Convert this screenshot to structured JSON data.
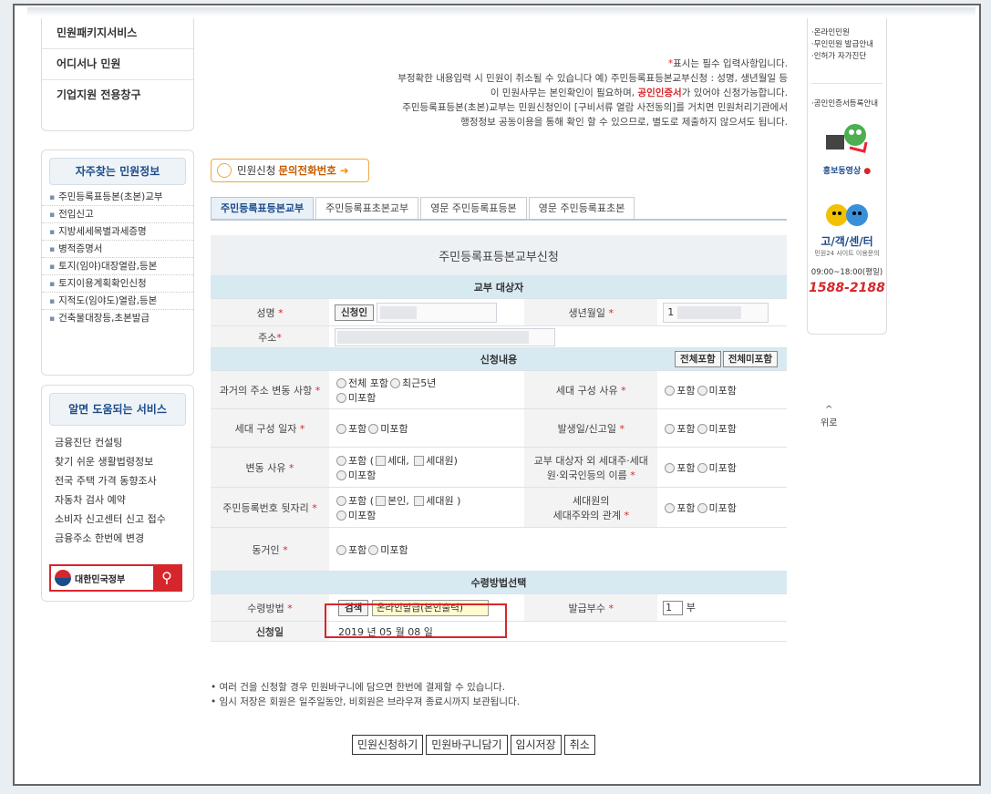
{
  "sidebar_top": [
    "민원패키지서비스",
    "어디서나 민원",
    "기업지원 전용창구"
  ],
  "faq": {
    "title": "자주찾는 민원정보",
    "items": [
      "주민등록표등본(초본)교부",
      "전입신고",
      "지방세세목별과세증명",
      "병적증명서",
      "토지(임야)대장열람,등본",
      "토지이용계획확인신청",
      "지적도(임야도)열람,등본",
      "건축물대장등,초본발급"
    ]
  },
  "useful": {
    "title": "알면 도움되는 서비스",
    "items": [
      "금융진단 컨설팅",
      "찾기 쉬운 생활법령정보",
      "전국 주택 가격 동향조사",
      "자동차 검사 예약",
      "소비자 신고센터 신고 접수",
      "금융주소 한번에 변경"
    ],
    "gov_label": "대한민국정부"
  },
  "notes": {
    "line1_star": "*",
    "line1": "표시는 필수 입력사항입니다.",
    "line2": "부정확한 내용입력 시 민원이 취소될 수 있습니다   예) 주민등록표등본교부신청 : 성명, 생년월일 등",
    "line3a": "이 민원사무는 본인확인이 필요하며, ",
    "line3b": "공인인증서",
    "line3c": "가 있어야 신청가능합니다.",
    "line4": "주민등록표등본(초본)교부는 민원신청인이 [구비서류 열람 사전동의]를 거치면 민원처리기관에서",
    "line5": "행정정보 공동이용을 통해 확인 할 수 있으므로, 별도로 제출하지 않으셔도 됩니다."
  },
  "inquiry": {
    "a": "민원신청",
    "b": "문의전화번호",
    "arrow": "➔"
  },
  "tabs": [
    "주민등록표등본교부",
    "주민등록표초본교부",
    "영문 주민등록표등본",
    "영문 주민등록표초본"
  ],
  "form": {
    "title": "주민등록표등본교부신청",
    "sec_target": "교부 대상자",
    "name_label": "성명",
    "applicant_btn": "신청인",
    "birth_label": "생년월일",
    "birth_prefix": "1",
    "addr_label": "주소",
    "sec_content": "신청내용",
    "include_all": "전체포함",
    "exclude_all": "전체미포함",
    "past_addr_label": "과거의 주소 변동 사항",
    "past_addr_opt1": "전체 포함",
    "past_addr_opt2": "최근5년",
    "exclude": "미포함",
    "include": "포함",
    "household_reason": "세대 구성 사유",
    "household_date": "세대 구성 일자",
    "occur_date": "발생일/신고일",
    "change_reason": "변동 사유",
    "chk_household": "세대,",
    "chk_member": "세대원)",
    "other_names_1": "교부 대상자 외 세대주·세대",
    "other_names_2": "원·외국인등의 이름",
    "rrn_label": "주민등록번호 뒷자리",
    "chk_self": "본인,",
    "chk_member2": "세대원 )",
    "rel_1": "세대원의",
    "rel_2": "세대주와의 관계",
    "cohabitant": "동거인",
    "sec_receive": "수령방법선택",
    "receive_label": "수령방법",
    "search_btn": "검색",
    "method_value": "온라인발급(본인출력)",
    "copies_label": "발급부수",
    "copies_value": "1",
    "copies_unit": "부",
    "apply_date_label": "신청일",
    "apply_date_value": "2019   년 05   월 08   일",
    "star": "*",
    "paren_open": "("
  },
  "bullets": [
    "• 여러 건을 신청할 경우 민원바구니에 담으면 한번에 결제할 수 있습니다.",
    "• 임시 저장은 회원은 일주일동안, 비회원은 브라우져 종료시까지 보관됩니다."
  ],
  "actions": [
    "민원신청하기",
    "민원바구니담기",
    "임시저장",
    "취소"
  ],
  "right": {
    "links": [
      "·온라인민원",
      "·무인민원 발급안내",
      "·인허가 자가진단",
      "·공인인증서등록안내"
    ],
    "promo": "홍보동영상",
    "cc_title": "고/객/센/터",
    "cc_sub": "민원24 사이트 이용문의",
    "cc_hours": "09:00~18:00(평일)",
    "cc_phone": "1588-2188",
    "top": "위로"
  }
}
